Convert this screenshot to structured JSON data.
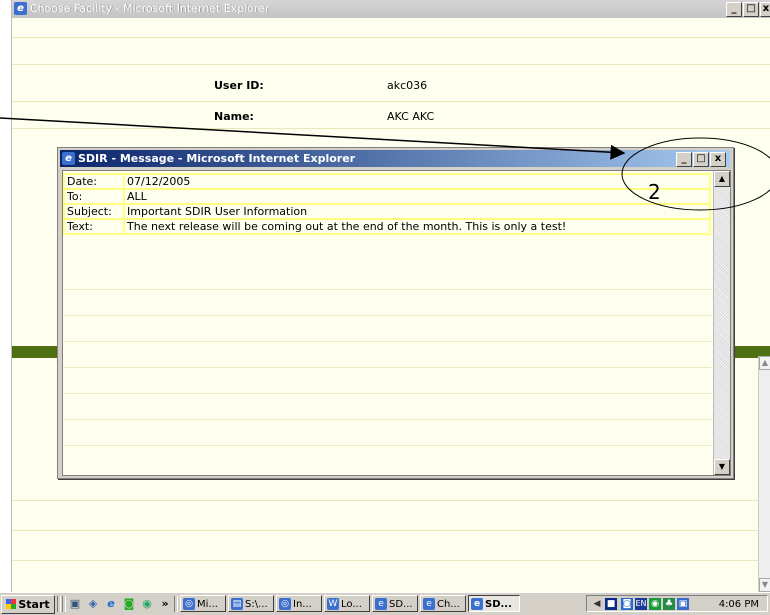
{
  "background_window": {
    "title": "Choose Facility - Microsoft Internet Explorer",
    "fields": [
      {
        "label": "User ID:",
        "value": "akc036"
      },
      {
        "label": "Name:",
        "value": "AKC AKC"
      }
    ]
  },
  "popup": {
    "title": "SDIR - Message - Microsoft Internet Explorer",
    "rows": [
      {
        "label": "Date:",
        "value": "07/12/2005"
      },
      {
        "label": "To:",
        "value": "ALL"
      },
      {
        "label": "Subject:",
        "value": "Important SDIR User Information"
      },
      {
        "label": "Text:",
        "value": "The next release will be coming out at the end of the month. This is only a test!"
      }
    ]
  },
  "annotation": {
    "number": "2"
  },
  "taskbar": {
    "start_label": "Start",
    "more_label": "»",
    "buttons": [
      "Mi...",
      "S:\\...",
      "In...",
      "Lo...",
      "SD...",
      "Ch...",
      "SD..."
    ],
    "clock": "4:06 PM",
    "tray_lang": "EN"
  },
  "colors": {
    "popup_title_start": "#0a246a",
    "popup_title_end": "#a6caf0",
    "band": "#4e6f12",
    "table_border": "#ffff80",
    "page_bg": "#fffff0"
  }
}
